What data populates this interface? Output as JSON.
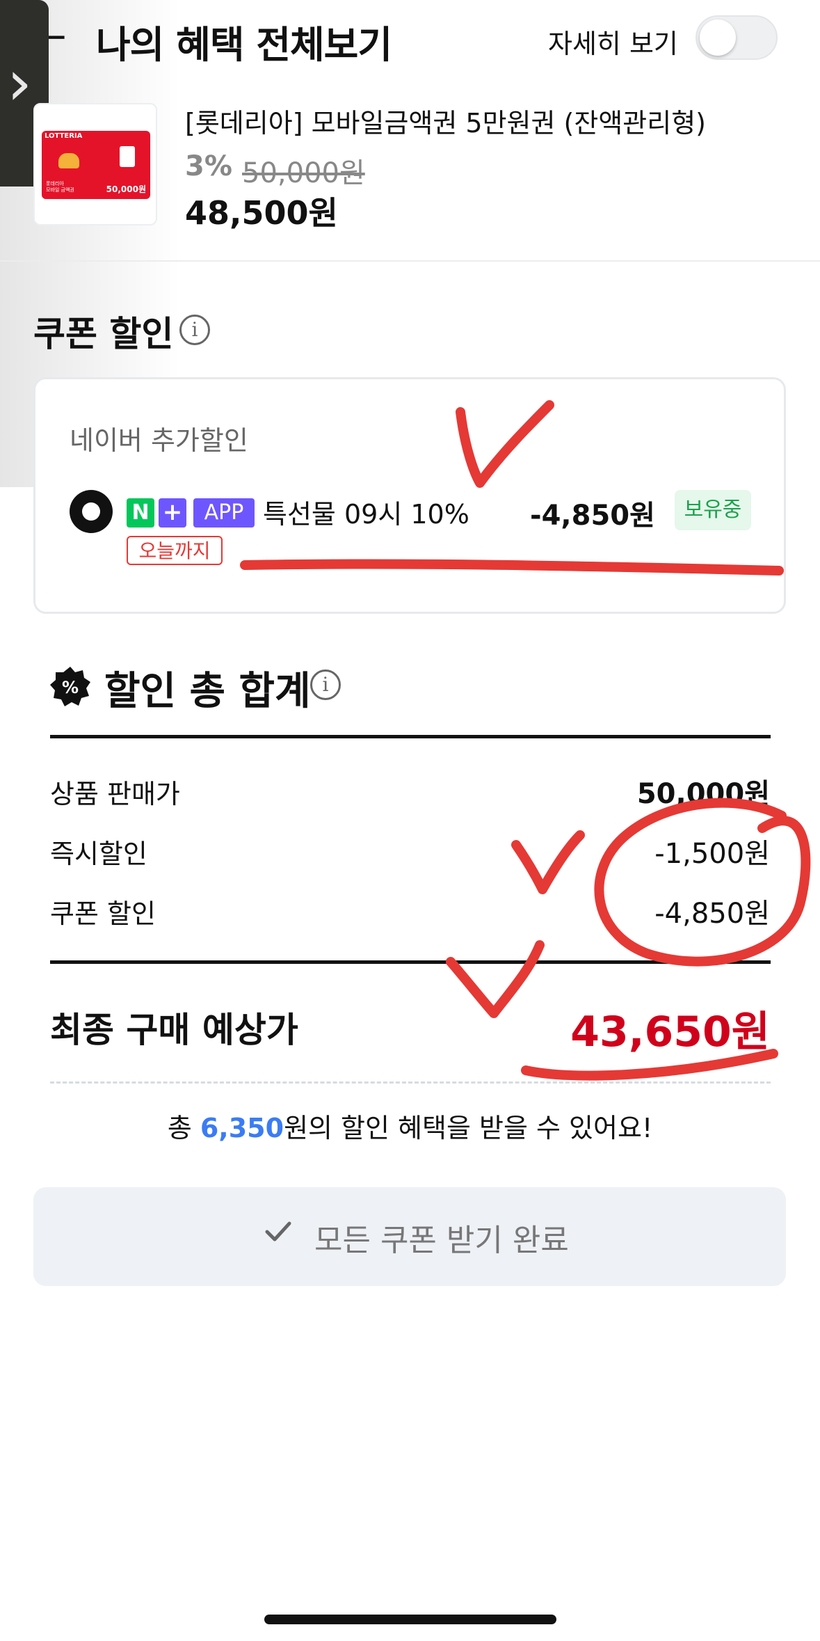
{
  "header": {
    "back_icon": "back-arrow-icon",
    "title": "나의 혜택 전체보기",
    "detail_toggle_label": "자세히 보기",
    "detail_toggle_on": false
  },
  "product": {
    "name": "[롯데리아] 모바일금액권 5만원권 (잔액관리형)",
    "discount_rate": "3%",
    "original_price": "50,000원",
    "sale_price": "48,500원",
    "card_brand": "LOTTERIA",
    "card_amount": "50,000원",
    "card_caption_1": "롯데리아",
    "card_caption_2": "모바일 금액권"
  },
  "coupon": {
    "title": "쿠폰 할인",
    "subtitle": "네이버 추가할인",
    "item": {
      "badge_n": "N",
      "badge_plus": "+",
      "badge_app": "APP",
      "name": "특선물 09시 10%",
      "amount": "-4,850원",
      "status": "보유중",
      "expiry_tag": "오늘까지",
      "selected": true
    }
  },
  "total": {
    "title": "할인 총 합계",
    "badge_icon": "%",
    "rows": [
      {
        "label": "상품 판매가",
        "value": "50,000원",
        "bold": true
      },
      {
        "label": "즉시할인",
        "value": "-1,500원",
        "bold": false
      },
      {
        "label": "쿠폰 할인",
        "value": "-4,850원",
        "bold": false
      }
    ],
    "final_label": "최종 구매 예상가",
    "final_value": "43,650원",
    "summary_prefix": "총 ",
    "summary_highlight": "6,350",
    "summary_suffix": "원의 할인 혜택을 받을 수 있어요!"
  },
  "action": {
    "done_label": "모든 쿠폰 받기 완료"
  },
  "colors": {
    "final_price": "#d0021b",
    "highlight": "#3b7cf4",
    "naver_green": "#03c75a",
    "plus_purple": "#6e56ff",
    "annotation_red": "#e53935"
  }
}
